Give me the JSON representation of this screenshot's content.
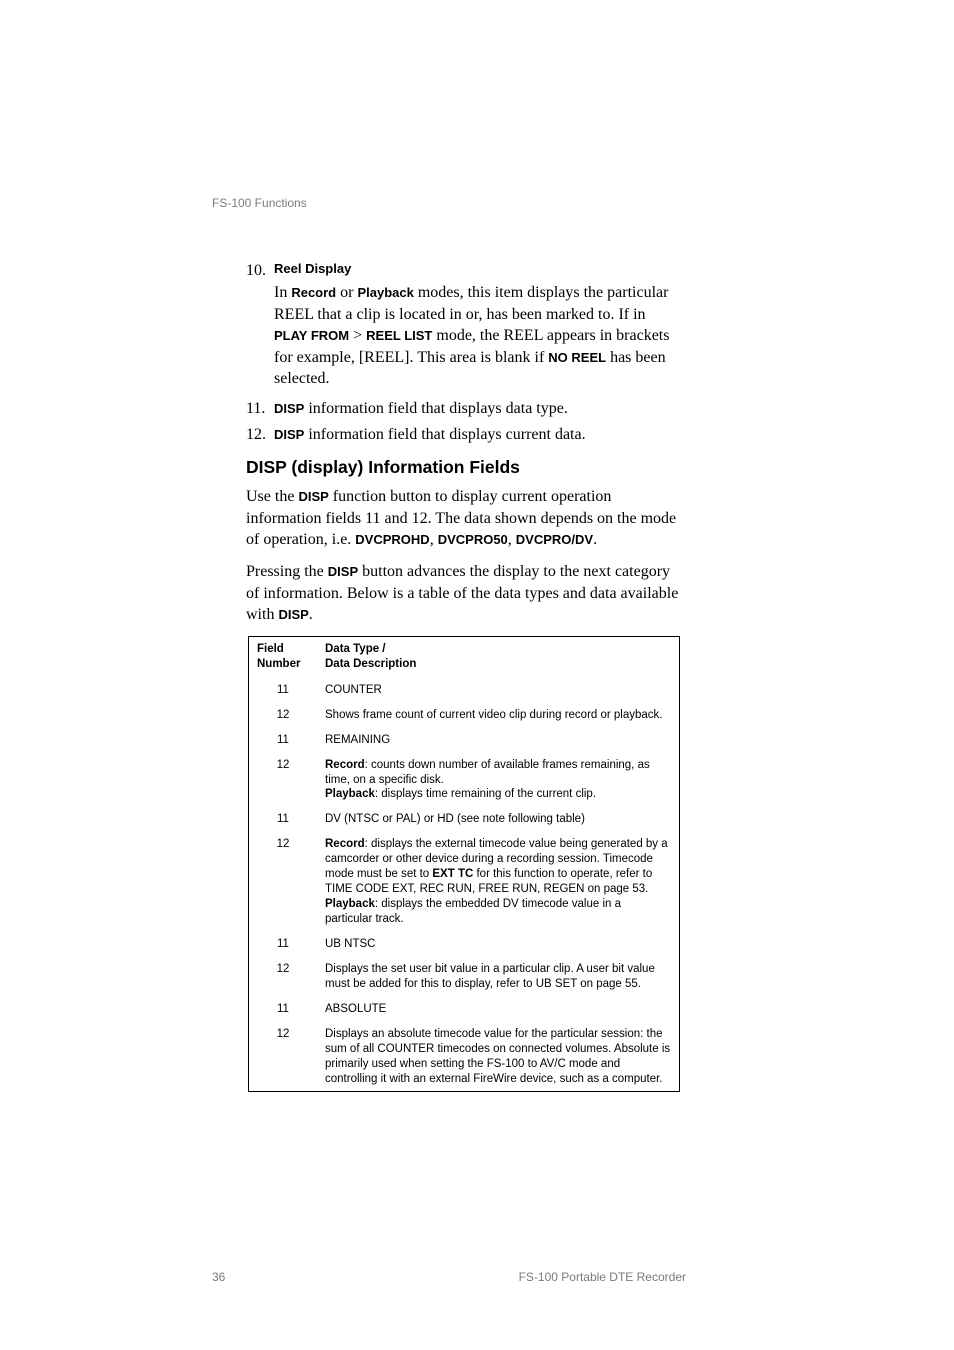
{
  "running_head": "FS-100 Functions",
  "list": {
    "item10": {
      "num": "10.",
      "title": "Reel Display",
      "text_before_record": "In ",
      "record": "Record",
      "or": " or ",
      "playback": "Playback",
      "after_playback": " modes, this item displays the particular REEL that a clip is located in or, has been marked to. If in ",
      "play_from": "PLAY FROM",
      "gt": " > ",
      "reel_list": "REEL LIST",
      "after_reel_list": " mode, the REEL appears in brackets for example, [REEL].  This area is blank if ",
      "no_reel": "NO REEL",
      "tail": " has been selected."
    },
    "item11": {
      "num": "11.",
      "disp": "DISP",
      "rest": " information field that displays data type."
    },
    "item12": {
      "num": "12.",
      "disp": "DISP",
      "rest": " information field that displays current data."
    }
  },
  "heading": "DISP (display) Information Fields",
  "prose1": {
    "a": "Use the ",
    "disp": "DISP",
    "b": " function button to display current operation information fields 11 and 12. The data shown depends on the mode of operation, i.e. ",
    "dvcprohd": "DVCPROHD",
    "c1": ", ",
    "dvcpro50": "DVCPRO50",
    "c2": ", ",
    "dvcprodv": "DVCPRO/DV",
    "tail": "."
  },
  "prose2": {
    "a": "Pressing the ",
    "disp": "DISP",
    "b": " button advances the display to the next category of information. Below is a table of the data types and data available with ",
    "disp2": "DISP",
    "tail": "."
  },
  "table": {
    "head": {
      "col1a": "Field",
      "col1b": "Number",
      "col2a": "Data Type /",
      "col2b": "Data Description"
    },
    "rows": [
      {
        "f": "11",
        "desc": {
          "plain": "COUNTER"
        }
      },
      {
        "f": "12",
        "desc": {
          "plain": "Shows frame count of current video clip during record or playback."
        }
      },
      {
        "f": "11",
        "desc": {
          "plain": "REMAINING"
        }
      },
      {
        "f": "12",
        "desc": {
          "rec": "Record",
          "rec_rest": ": counts down number of available frames remaining, as time, on a specific disk.",
          "br": true,
          "pb": "Playback",
          "pb_rest": ": displays time remaining of the current clip."
        }
      },
      {
        "f": "11",
        "desc": {
          "plain": "DV (NTSC or PAL) or HD (see note following table)"
        }
      },
      {
        "f": "12",
        "desc": {
          "rec": "Record",
          "rec_rest": ": displays the external timecode value being generated by a camcorder or other device during a recording session. Timecode mode must be set to ",
          "bold2": "EXT TC",
          "rec_rest2": " for this function to operate, refer to TIME CODE EXT, REC RUN, FREE RUN, REGEN on page 53.",
          "br": true,
          "pb": "Playback",
          "pb_rest": ": displays the embedded DV timecode value in a particular track."
        }
      },
      {
        "f": "11",
        "desc": {
          "plain": "UB NTSC"
        }
      },
      {
        "f": "12",
        "desc": {
          "plain": "Displays the set user bit value in a particular clip. A user bit value must be added for this to display, refer to UB SET on page 55."
        }
      },
      {
        "f": "11",
        "desc": {
          "plain": "ABSOLUTE"
        }
      },
      {
        "f": "12",
        "desc": {
          "plain": "Displays an absolute timecode value for the particular session: the sum of all COUNTER timecodes on connected volumes. Absolute is primarily used when setting the FS-100 to AV/C mode and controlling it with an external FireWire device, such as a computer."
        }
      }
    ]
  },
  "footer": {
    "page": "36",
    "pub": "FS-100 Portable DTE Recorder"
  }
}
